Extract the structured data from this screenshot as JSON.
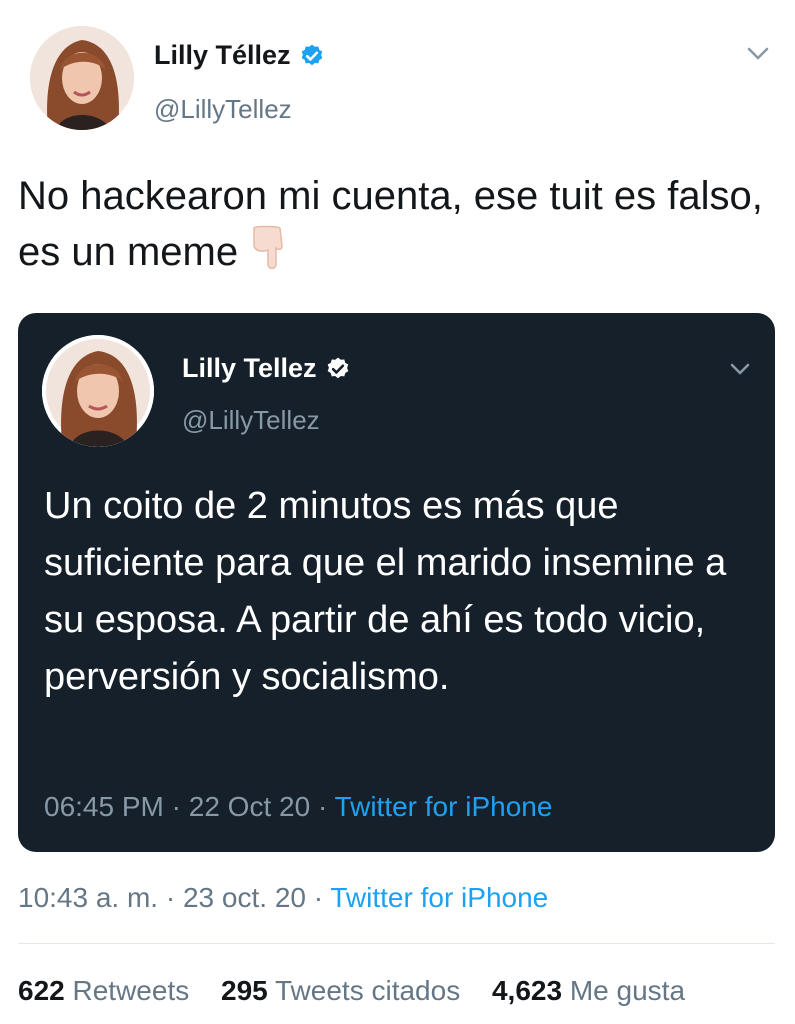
{
  "tweet": {
    "author_name": "Lilly Téllez",
    "author_handle": "@LillyTellez",
    "text": "No hackearon mi cuenta, ese tuit es falso, es un meme",
    "emoji": "pointing-down-hand",
    "time": "10:43 a. m.",
    "date": "23 oct. 20",
    "source": "Twitter for iPhone",
    "separator": "·"
  },
  "quoted": {
    "author_name": "Lilly Tellez",
    "author_handle": "@LillyTellez",
    "text": "Un coito de 2 minutos es más que suficiente para que el marido insemine a su esposa. A partir de ahí es todo vicio, perversión y socialismo.",
    "time": "06:45 PM",
    "date": "22 Oct 20",
    "source": "Twitter for iPhone",
    "separator": "·"
  },
  "stats": {
    "retweets_count": "622",
    "retweets_label": "Retweets",
    "quotes_count": "295",
    "quotes_label": "Tweets citados",
    "likes_count": "4,623",
    "likes_label": "Me gusta"
  },
  "colors": {
    "verified": "#1da1f2",
    "dark_card": "#15202b",
    "link": "#1da1f2"
  }
}
